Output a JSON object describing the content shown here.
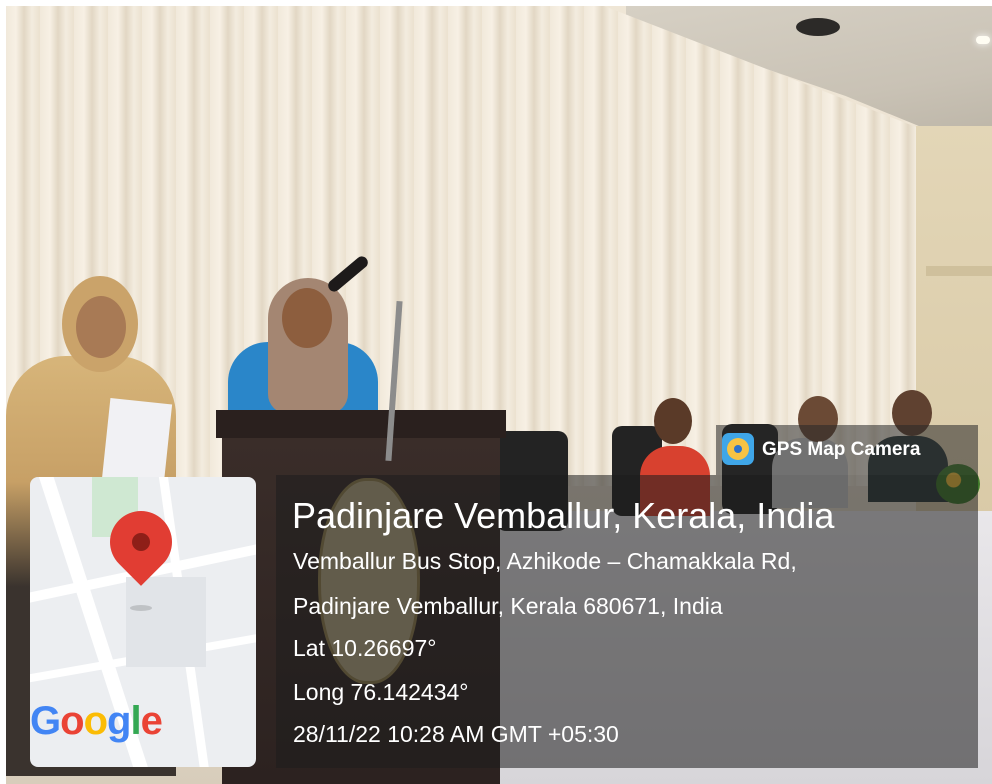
{
  "badge": {
    "label": "GPS Map Camera",
    "icon": "gps-map-camera-icon"
  },
  "location": {
    "title": "Padinjare Vemballur, Kerala, India",
    "address_line1": "Vemballur Bus Stop, Azhikode – Chamakkala Rd,",
    "address_line2": "Padinjare Vemballur, Kerala 680671, India",
    "lat": "Lat 10.26697°",
    "long": "Long 76.142434°",
    "timestamp": "28/11/22 10:28 AM GMT +05:30"
  },
  "map": {
    "logo_parts": [
      "G",
      "o",
      "o",
      "g",
      "l",
      "e"
    ],
    "pin_color": "#e13d33"
  }
}
